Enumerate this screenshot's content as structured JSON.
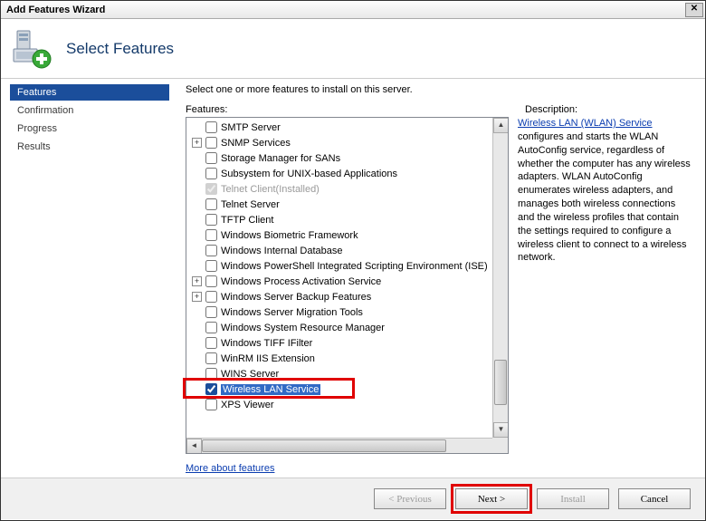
{
  "window": {
    "title": "Add Features Wizard"
  },
  "header": {
    "page_title": "Select Features"
  },
  "nav": {
    "items": [
      {
        "label": "Features",
        "active": true
      },
      {
        "label": "Confirmation",
        "active": false
      },
      {
        "label": "Progress",
        "active": false
      },
      {
        "label": "Results",
        "active": false
      }
    ]
  },
  "main": {
    "instruction": "Select one or more features to install on this server.",
    "features_label": "Features:",
    "more_link": "More about features",
    "tree": [
      {
        "label": "SMTP Server",
        "expander": null,
        "checked": false
      },
      {
        "label": "SNMP Services",
        "expander": "+",
        "checked": false
      },
      {
        "label": "Storage Manager for SANs",
        "expander": null,
        "checked": false
      },
      {
        "label": "Subsystem for UNIX-based Applications",
        "expander": null,
        "checked": false
      },
      {
        "label": "Telnet Client",
        "suffix": "(Installed)",
        "expander": null,
        "checked": true,
        "disabled": true
      },
      {
        "label": "Telnet Server",
        "expander": null,
        "checked": false
      },
      {
        "label": "TFTP Client",
        "expander": null,
        "checked": false
      },
      {
        "label": "Windows Biometric Framework",
        "expander": null,
        "checked": false
      },
      {
        "label": "Windows Internal Database",
        "expander": null,
        "checked": false
      },
      {
        "label": "Windows PowerShell Integrated Scripting Environment (ISE)",
        "expander": null,
        "checked": false
      },
      {
        "label": "Windows Process Activation Service",
        "expander": "+",
        "checked": false
      },
      {
        "label": "Windows Server Backup Features",
        "expander": "+",
        "checked": false
      },
      {
        "label": "Windows Server Migration Tools",
        "expander": null,
        "checked": false
      },
      {
        "label": "Windows System Resource Manager",
        "expander": null,
        "checked": false
      },
      {
        "label": "Windows TIFF IFilter",
        "expander": null,
        "checked": false
      },
      {
        "label": "WinRM IIS Extension",
        "expander": null,
        "checked": false
      },
      {
        "label": "WINS Server",
        "expander": null,
        "checked": false
      },
      {
        "label": "Wireless LAN Service",
        "expander": null,
        "checked": true,
        "selected": true
      },
      {
        "label": "XPS Viewer",
        "expander": null,
        "checked": false
      }
    ]
  },
  "description": {
    "label": "Description:",
    "link_text": "Wireless LAN (WLAN) Service",
    "body": " configures and starts the WLAN AutoConfig service, regardless of whether the computer has any wireless adapters. WLAN AutoConfig enumerates wireless adapters, and manages both wireless connections and the wireless profiles that contain the settings required to configure a wireless client to connect to a wireless network."
  },
  "buttons": {
    "previous": "< Previous",
    "next": "Next >",
    "install": "Install",
    "cancel": "Cancel"
  }
}
